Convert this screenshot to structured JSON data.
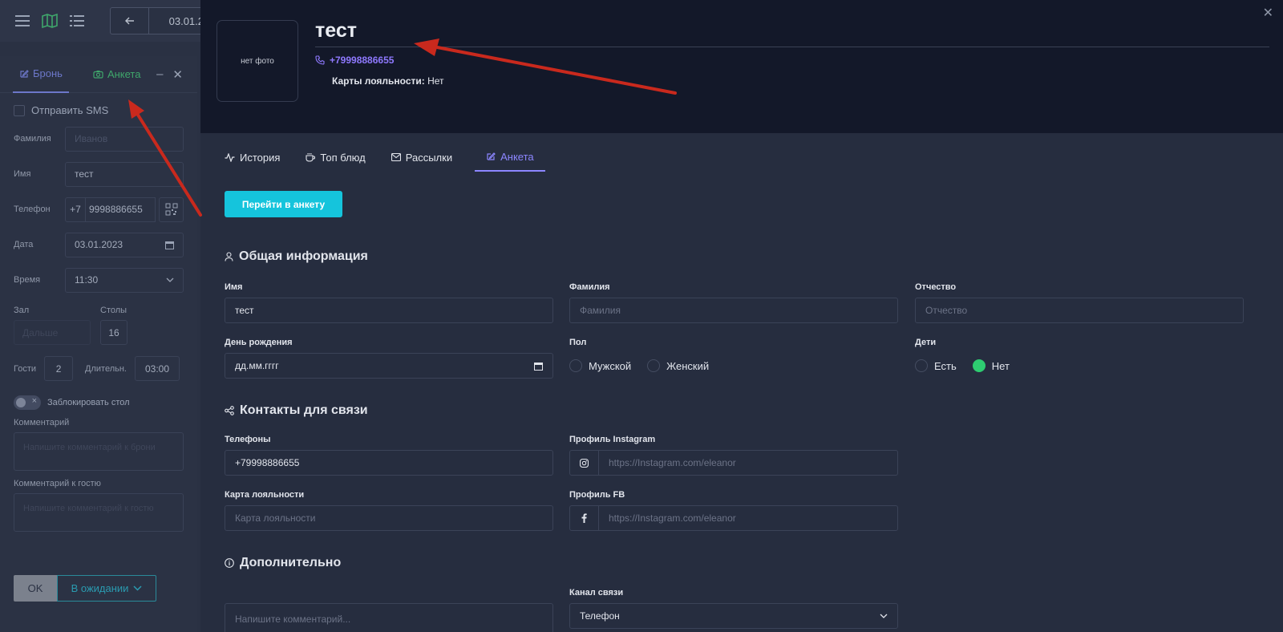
{
  "topbar": {
    "date_text": "03.01.2"
  },
  "left_panel": {
    "tab_booking": "Бронь",
    "tab_form": "Анкета",
    "send_sms": "Отправить SMS",
    "surname_label": "Фамилия",
    "surname_placeholder": "Иванов",
    "name_label": "Имя",
    "name_value": "тест",
    "phone_label": "Телефон",
    "phone_prefix": "+7",
    "phone_value": "9998886655",
    "date_label": "Дата",
    "date_value": "03.01.2023",
    "time_label": "Время",
    "time_value": "11:30",
    "hall_label": "Зал",
    "hall_placeholder": "Дальше",
    "tables_label": "Столы",
    "tables_value": "16",
    "guests_label": "Гости",
    "guests_value": "2",
    "duration_label": "Длительн.",
    "duration_value": "03:00",
    "lock_table": "Заблокировать стол",
    "comment_label": "Комментарий",
    "comment_placeholder": "Напишите комментарий к брони",
    "guest_comment_label": "Комментарий к гостю",
    "guest_comment_placeholder": "Напишите комментарий к гостю",
    "ok_button": "OK",
    "status_button": "В ожидании"
  },
  "modal": {
    "photo_text": "нет фото",
    "client_name": "тест",
    "client_phone": "+79998886655",
    "loyalty_label": "Карты лояльности:",
    "loyalty_value": "Нет",
    "tabs": [
      {
        "label": "История"
      },
      {
        "label": "Топ блюд"
      },
      {
        "label": "Рассылки"
      },
      {
        "label": "Анкета"
      }
    ],
    "go_button": "Перейти в анкету",
    "general": {
      "title": "Общая информация",
      "name_label": "Имя",
      "name_value": "тест",
      "surname_label": "Фамилия",
      "surname_placeholder": "Фамилия",
      "patronymic_label": "Отчество",
      "patronymic_placeholder": "Отчество",
      "birthday_label": "День рождения",
      "birthday_placeholder": "дд.мм.гггг",
      "gender_label": "Пол",
      "gender_male": "Мужской",
      "gender_female": "Женский",
      "children_label": "Дети",
      "children_yes": "Есть",
      "children_no": "Нет"
    },
    "contacts": {
      "title": "Контакты для связи",
      "phones_label": "Телефоны",
      "phones_value": "+79998886655",
      "instagram_label": "Профиль Instagram",
      "instagram_placeholder": "https://Instagram.com/eleanor",
      "loyalty_card_label": "Карта лояльности",
      "loyalty_card_placeholder": "Карта лояльности",
      "fb_label": "Профиль FB",
      "fb_placeholder": "https://Instagram.com/eleanor"
    },
    "extra": {
      "title": "Дополнительно",
      "comment_placeholder": "Напишите комментарий...",
      "channel_label": "Канал связи",
      "channel_value": "Телефон"
    }
  },
  "colors": {
    "accent_purple": "#8c86ff",
    "accent_cyan": "#15c4dc",
    "accent_green": "#2ecc71"
  }
}
